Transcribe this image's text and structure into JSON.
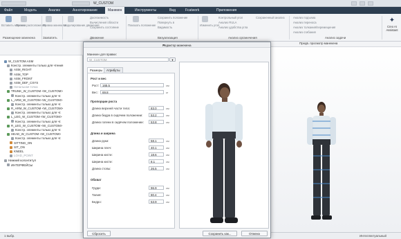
{
  "window": {
    "title": "W_CUSTOM"
  },
  "menu": {
    "items": [
      "Файл",
      "Модель",
      "Анализ",
      "Аннотирование",
      "Манекен",
      "Инструменты",
      "Вид",
      "Fcatwork",
      "Приложения"
    ],
    "active_index": 4
  },
  "ribbon": {
    "groups": [
      "Размещение манекена",
      "Захватить",
      "Движение",
      "Визуализация",
      "Анализ органичения",
      "Анализ задачи"
    ],
    "buttons": [
      "Вставить манекен",
      "Правка расположения",
      "Правка манекена",
      "Моделирование движения",
      "Показать положение",
      "Изменить угол",
      "Цифровой ассистент"
    ],
    "small": [
      "Досягаемость",
      "Вычисления области",
      "Сохранить состояние",
      "Сохранить положение",
      "Повернуть в",
      "Видимость",
      "Контрольный угол",
      "Анализ RULA",
      "Анализ удобства угла",
      "Сохраненный анализ",
      "Анализ подъема",
      "Анализ переноса",
      "Анализ толкания/перемещения",
      "Анализ сгибания"
    ],
    "ai_label": "Creo AI Assistant"
  },
  "tree": {
    "nodes": [
      "W_CUSTOM.ASM",
      "Констр. элементы только для чтения",
      "ASM_RIGHT",
      "ASM_TOP",
      "ASM_FRONT",
      "ASM_DEF_CSYS",
      "Начальная точка",
      "TRUNK_W_CUSTOM <W_CUSTOM>",
      "Констр. элементы только для чт.",
      "L_ARM_W_CUSTOM <W_CUSTOM>",
      "Констр. элементы только для чт.",
      "R_ARM_W_CUSTOM <W_CUSTOM>",
      "Констр. элементы только для чт.",
      "L_LEG_W_CUSTOM <W_CUSTOM>",
      "Констр. элементы только для чт.",
      "R_LEG_W_CUSTOM <W_CUSTOM>",
      "Констр. элементы только для чт.",
      "HEAD_W_CUSTOM <W_CUSTOM>",
      "Констр. элементы только для чт.",
      "SITTING_ON",
      "SIT_ON",
      "KNEEL",
      "LOAD_POINT",
      "Нижний колонтитул",
      "ИНТЕРФЕЙСЫ"
    ]
  },
  "viewport": {
    "title": "Предв. просмотр манекена"
  },
  "dialog": {
    "title": "Редактор манекена",
    "label_for": "Манекен для правки:",
    "model_value": "W_CUSTOM",
    "tabs": [
      "Размеры",
      "Атрибуты"
    ],
    "sections": {
      "height_weight": "Рост и вес",
      "proportions": "Пропорции роста",
      "length_width": "Длина и ширина",
      "girth": "Обхват"
    },
    "fields": [
      {
        "label": "Рост:",
        "value": "165.5",
        "unit": "см"
      },
      {
        "label": "Вес:",
        "value": "69.8",
        "unit": "кг"
      },
      {
        "label": "Длина верхней части тела:",
        "value": "83.0",
        "unit": "см"
      },
      {
        "label": "Длина бедра в сидячем положении:",
        "value": "53.2",
        "unit": "см"
      },
      {
        "label": "Длина голени в сидячем положении:",
        "value": "53.8",
        "unit": "см"
      },
      {
        "label": "Длина руки:",
        "value": "58.1",
        "unit": "см"
      },
      {
        "label": "Ширина плеч:",
        "value": "40.1",
        "unit": "см"
      },
      {
        "label": "Ширина кисти:",
        "value": "18.6",
        "unit": "см"
      },
      {
        "label": "Ширина кисти:",
        "value": "8.1",
        "unit": "см"
      },
      {
        "label": "Длина стопы:",
        "value": "26.5",
        "unit": "см"
      },
      {
        "label": "Груди:",
        "value": "96.9",
        "unit": "см"
      },
      {
        "label": "Талия:",
        "value": "80.4",
        "unit": "см"
      },
      {
        "label": "Бедро:",
        "value": "53.9",
        "unit": "см"
      }
    ],
    "btn_reset": "Сбросить",
    "btn_save": "Сохранить как...",
    "btn_cancel": "Отмена"
  },
  "status": {
    "left": "1 выбр.",
    "right": "Интеллектуальный"
  }
}
